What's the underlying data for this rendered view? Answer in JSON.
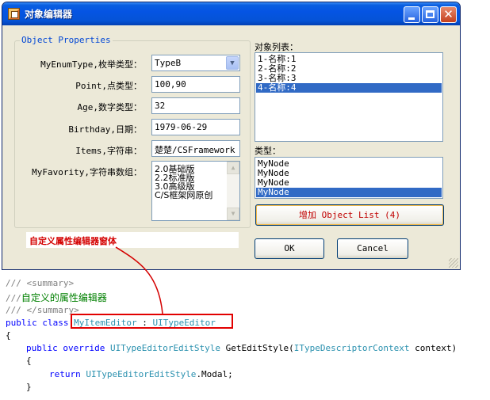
{
  "window": {
    "title": "对象编辑器",
    "close_symbol": "✕"
  },
  "group": {
    "legend": "Object Properties"
  },
  "properties": {
    "enum_label": "MyEnumType,枚举类型：",
    "enum_value": "TypeB",
    "point_label": "Point,点类型：",
    "point_value": "100,90",
    "age_label": "Age,数字类型：",
    "age_value": "32",
    "birthday_label": "Birthday,日期：",
    "birthday_value": "1979-06-29",
    "items_label": "Items,字符串：",
    "items_value": "楚楚/CSFramework",
    "favority_label": "MyFavority,字符串数组：",
    "favority_lines": [
      "2.0基础版",
      "2.2标准版",
      "3.0高级版",
      "C/S框架网原创"
    ]
  },
  "object_list": {
    "label": "对象列表：",
    "items": [
      "1-名称:1",
      "2-名称:2",
      "3-名称:3",
      "4-名称:4"
    ],
    "selected_index": 3
  },
  "type_list": {
    "label": "类型：",
    "items": [
      "MyNode",
      "MyNode",
      "MyNode",
      "MyNode"
    ],
    "selected_index": 3
  },
  "buttons": {
    "add_label": "增加 Object List (4)",
    "ok_label": "OK",
    "cancel_label": "Cancel"
  },
  "caption": "自定义属性编辑器窗体",
  "code": {
    "line1": "/// <summary>",
    "line2_prefix": "///",
    "line2_text": "自定义的属性编辑器",
    "line3": "/// </summary>",
    "line4_kw": "public class ",
    "line4_name": "MyItemEditor",
    "line4_colon": " : ",
    "line4_base": "UITypeEditor",
    "line5": "{",
    "line6_kw": "public override ",
    "line6_type": "UITypeEditorEditStyle",
    "line6_method": " GetEditStyle(",
    "line6_ptype": "ITypeDescriptorContext",
    "line6_param": " context)",
    "line7": "{",
    "line8_kw": "return ",
    "line8_type": "UITypeEditorEditStyle",
    "line8_rest": ".Modal;",
    "line9": "}"
  },
  "colors": {
    "title_bar": "#0554e3",
    "window_bg": "#ece9d8",
    "selection": "#316ac5",
    "annotation_red": "#e20000"
  }
}
